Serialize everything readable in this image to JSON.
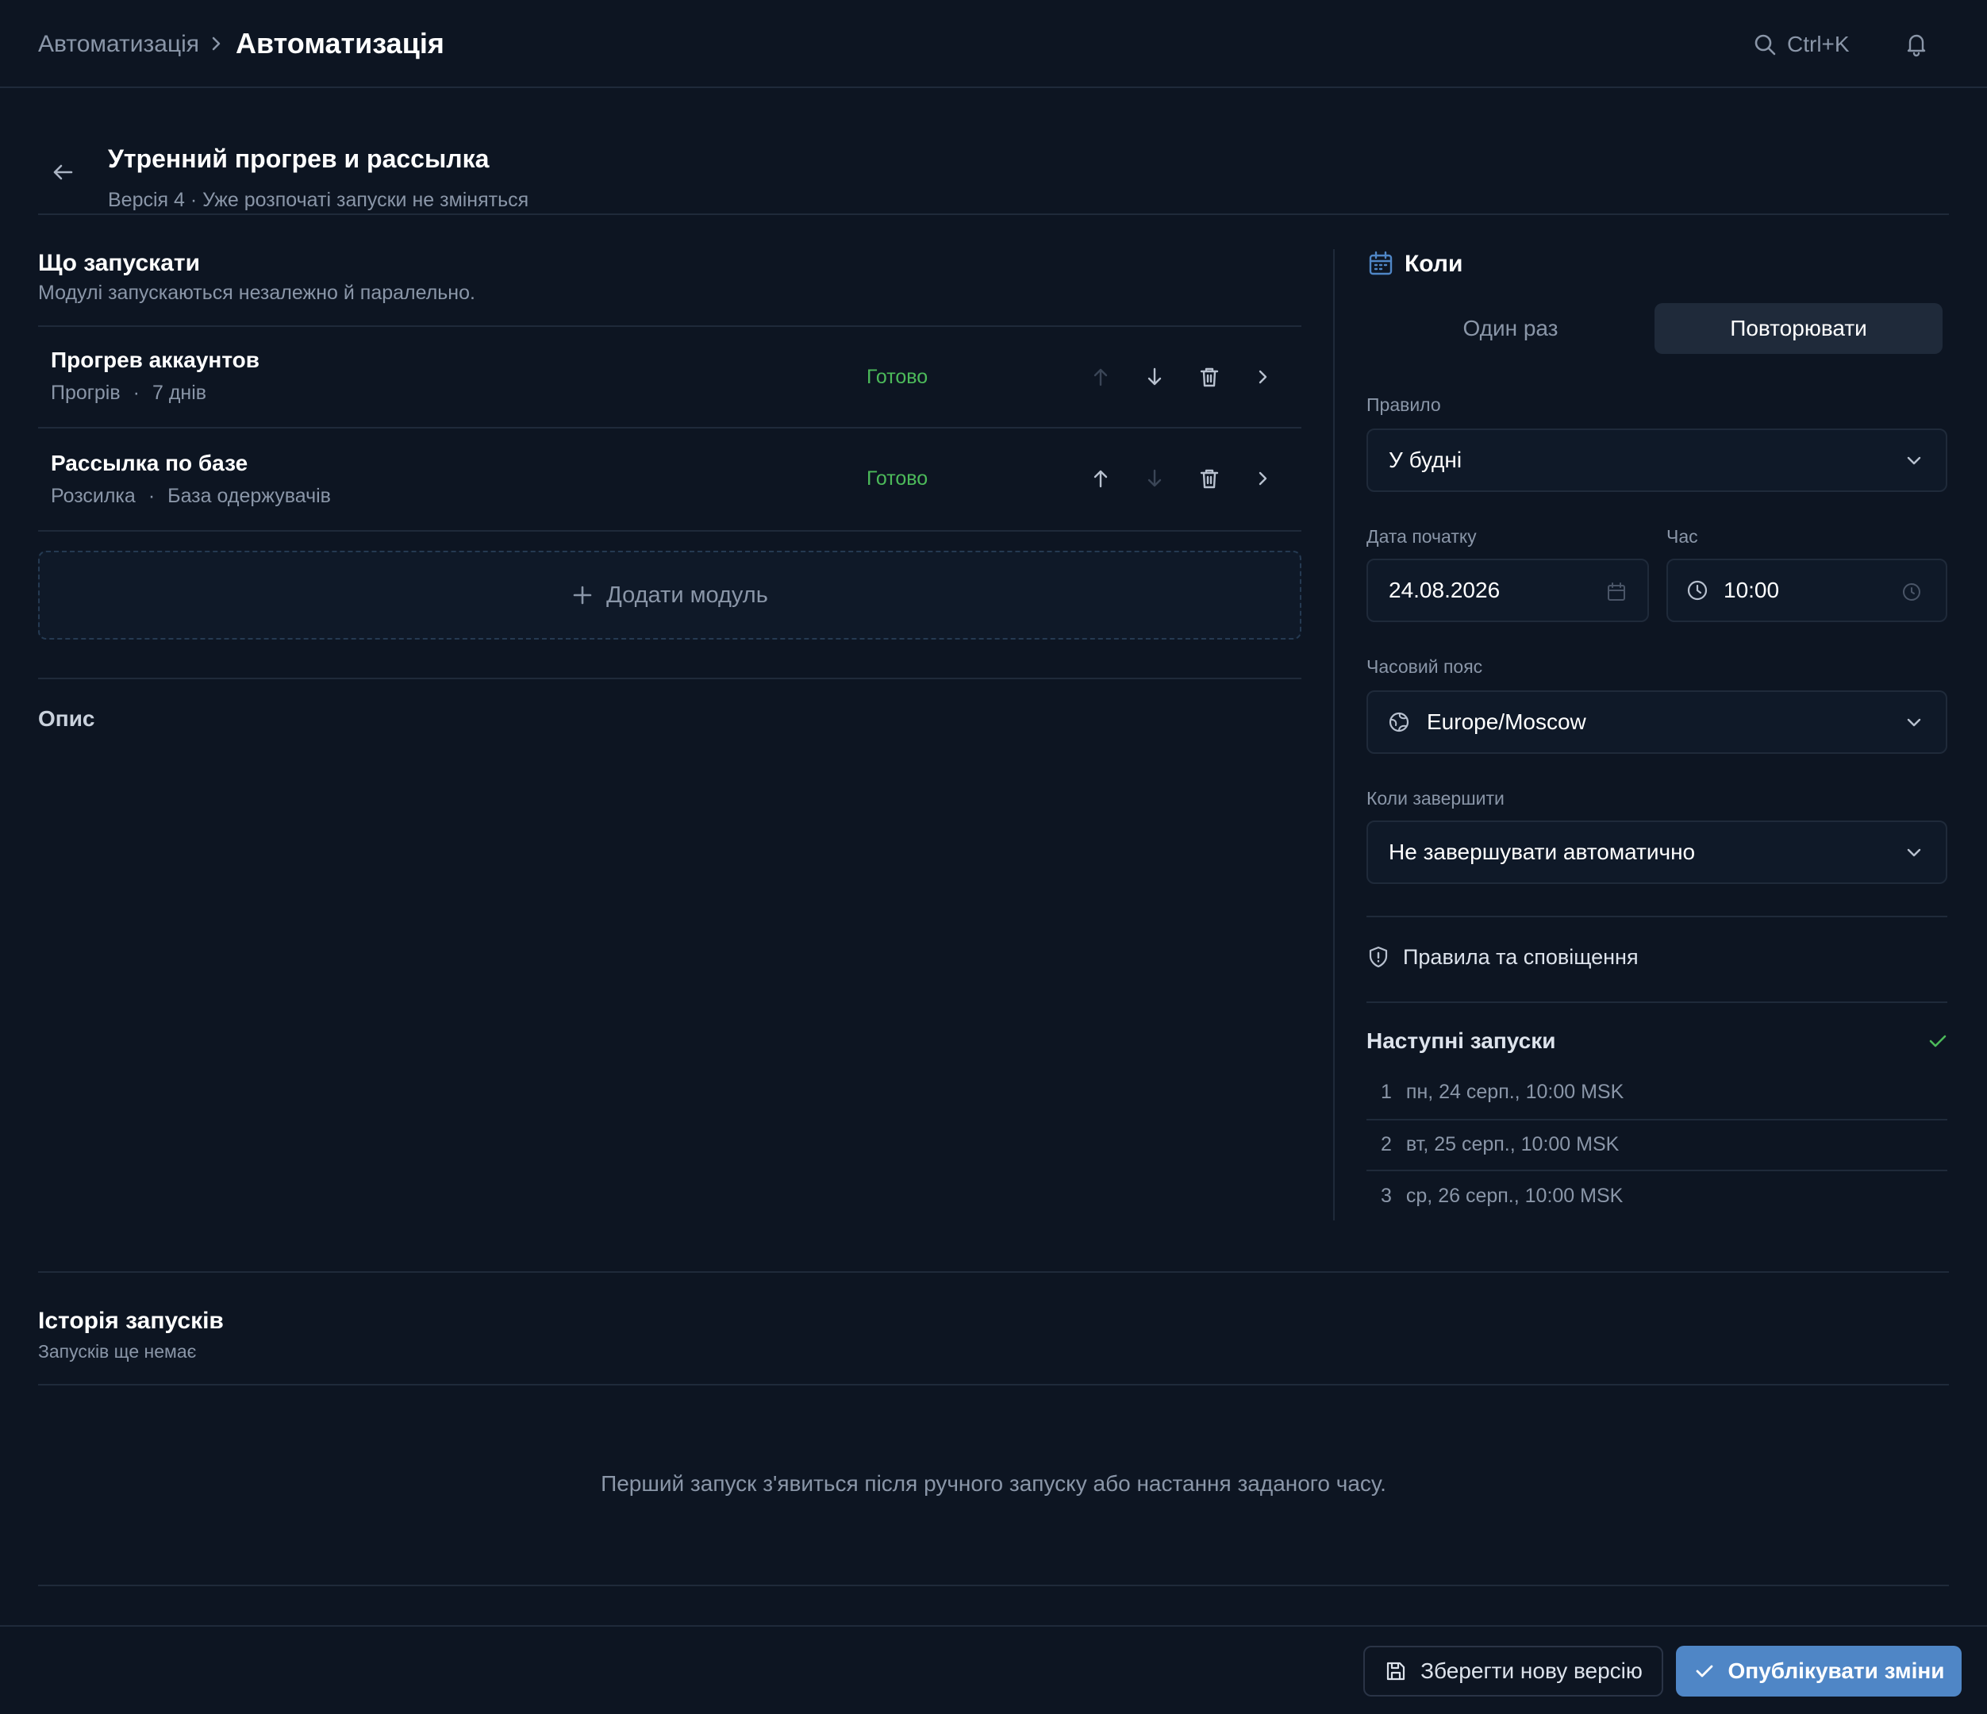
{
  "topbar": {
    "breadcrumb_parent": "Автоматизація",
    "breadcrumb_current": "Автоматизація",
    "search_shortcut": "Ctrl+K"
  },
  "header": {
    "title": "Утренний прогрев и рассылка",
    "subtitle": "Версія 4 · Уже розпочаті запуски не зміняться"
  },
  "what": {
    "title": "Що запускати",
    "description": "Модулі запускаються незалежно й паралельно.",
    "modules": [
      {
        "name": "Прогрев аккаунтов",
        "type": "Прогрів",
        "detail": "7 днів",
        "status": "Готово"
      },
      {
        "name": "Рассылка по базе",
        "type": "Розсилка",
        "detail": "База одержувачів",
        "status": "Готово"
      }
    ],
    "add_module_label": "Додати модуль",
    "meta_separator": "·"
  },
  "description_section": {
    "title": "Опис"
  },
  "when": {
    "title": "Коли",
    "tabs": [
      "Один раз",
      "Повторювати"
    ],
    "active_tab": "Повторювати",
    "rule_label": "Правило",
    "rule_value": "У будні",
    "start_date_label": "Дата початку",
    "start_date_value": "24.08.2026",
    "time_label": "Час",
    "time_value": "10:00",
    "timezone_label": "Часовий пояс",
    "timezone_value": "Europe/Moscow",
    "end_label": "Коли завершити",
    "end_value": "Не завершувати автоматично",
    "rules_notifications": "Правила та сповіщення",
    "next_runs_title": "Наступні запуски",
    "next_runs": [
      {
        "n": "1",
        "text": "пн, 24 серп., 10:00 MSK"
      },
      {
        "n": "2",
        "text": "вт, 25 серп., 10:00 MSK"
      },
      {
        "n": "3",
        "text": "ср, 26 серп., 10:00 MSK"
      }
    ]
  },
  "history": {
    "title": "Історія запусків",
    "subtitle": "Запусків ще немає",
    "empty_text": "Перший запуск з'явиться після ручного запуску або настання заданого часу."
  },
  "footer": {
    "save_label": "Зберегти нову версію",
    "publish_label": "Опублікувати зміни"
  },
  "colors": {
    "background": "#0d1522",
    "accent": "#4f86c6",
    "status_ready": "#4cba5a"
  }
}
